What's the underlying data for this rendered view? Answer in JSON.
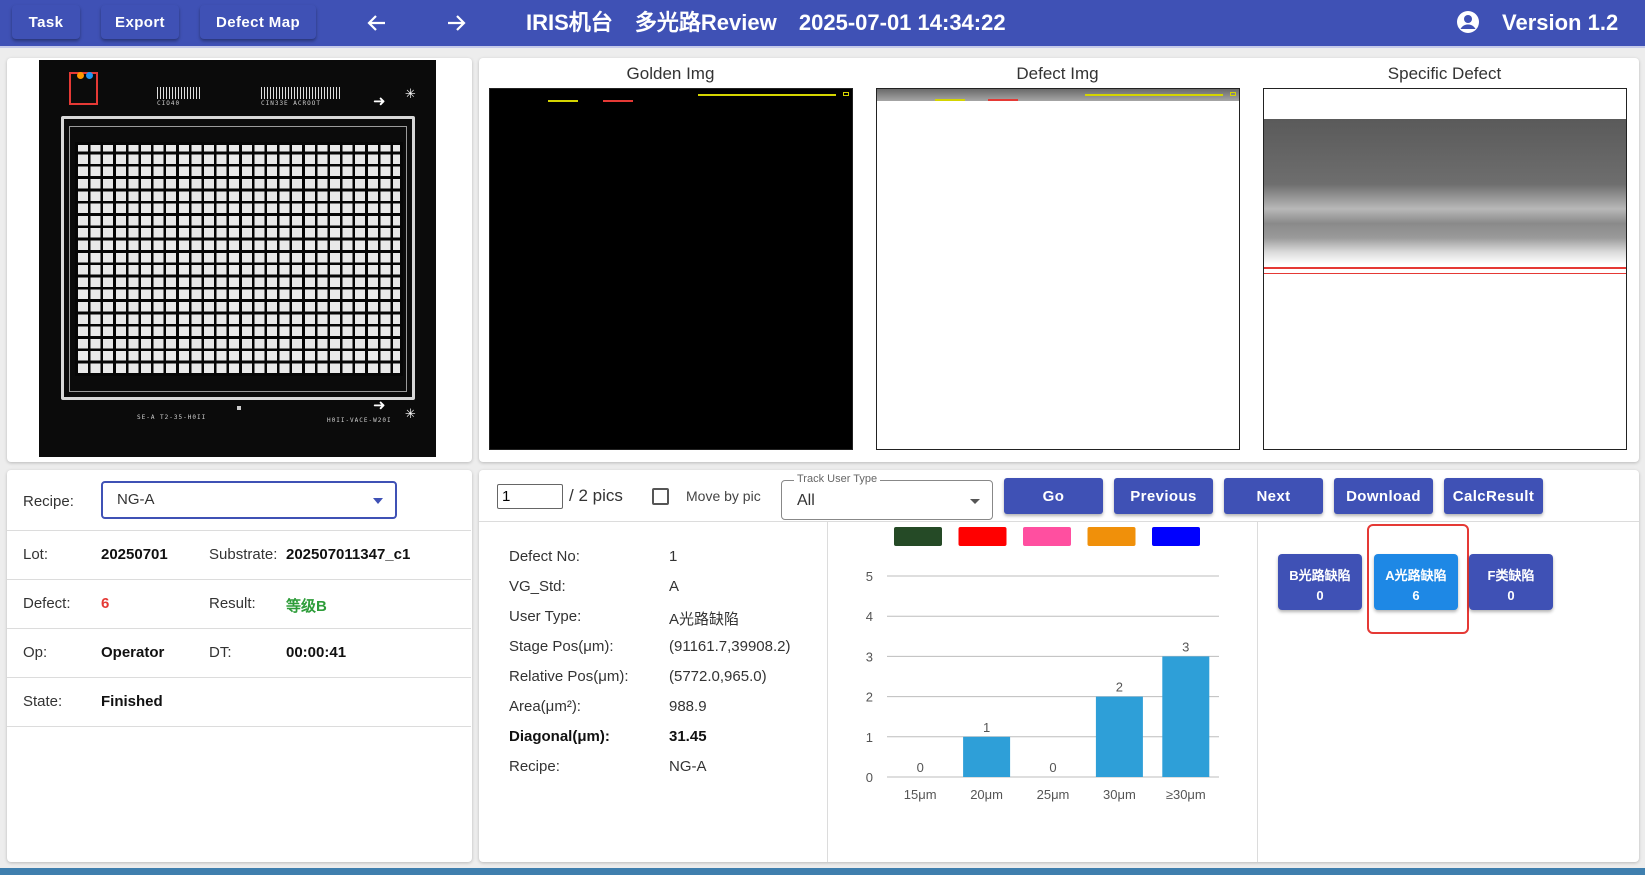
{
  "toolbar": {
    "task_label": "Task",
    "export_label": "Export",
    "defect_map_label": "Defect Map",
    "title_machine": "IRIS机台",
    "title_mode": "多光路Review",
    "title_datetime": "2025-07-01 14:34:22",
    "version": "Version 1.2",
    "icons": {
      "back": "arrow-left-icon",
      "forward": "arrow-right-icon",
      "user": "account-circle-icon"
    },
    "color": "#3f51b5"
  },
  "wafer": {
    "barcode_text_1": "CIO40",
    "barcode_text_2": "CIN33E ACROOT",
    "bottom_text_1": "SE-A T2-35-H0II",
    "bottom_text_2": "H0II-VACE-W20I"
  },
  "images": {
    "golden_title": "Golden Img",
    "defect_title": "Defect Img",
    "specific_title": "Specific Defect"
  },
  "info": {
    "recipe_label": "Recipe:",
    "recipe_value": "NG-A",
    "lot_label": "Lot:",
    "lot_value": "20250701",
    "substrate_label": "Substrate:",
    "substrate_value": "202507011347_c1",
    "defect_label": "Defect:",
    "defect_value": "6",
    "result_label": "Result:",
    "result_value": "等级B",
    "op_label": "Op:",
    "op_value": "Operator",
    "dt_label": "DT:",
    "dt_value": "00:00:41",
    "state_label": "State:",
    "state_value": "Finished",
    "colors": {
      "defect": "#e53935",
      "result": "#2e9d3a"
    }
  },
  "nav": {
    "page_value": "1",
    "total": "/ 2 pics",
    "move_by_pic_label": "Move by pic",
    "track_label": "Track User Type",
    "track_value": "All",
    "go_label": "Go",
    "previous_label": "Previous",
    "next_label": "Next",
    "download_label": "Download",
    "calc_label": "CalcResult"
  },
  "details": {
    "defect_no_label": "Defect No:",
    "defect_no_value": "1",
    "vg_std_label": "VG_Std:",
    "vg_std_value": "A",
    "user_type_label": "User Type:",
    "user_type_value": "A光路缺陷",
    "stage_pos_label": "Stage Pos(μm):",
    "stage_pos_value": "(91161.7,39908.2)",
    "relative_pos_label": "Relative Pos(μm):",
    "relative_pos_value": "(5772.0,965.0)",
    "area_label": "Area(μm²):",
    "area_value": "988.9",
    "diagonal_label": "Diagonal(μm):",
    "diagonal_value": "31.45",
    "recipe_label": "Recipe:",
    "recipe_value": "NG-A"
  },
  "chart_data": {
    "type": "bar",
    "categories": [
      "15μm",
      "20μm",
      "25μm",
      "30μm",
      "≥30μm"
    ],
    "values": [
      0,
      1,
      0,
      2,
      3
    ],
    "ylim": [
      0,
      5
    ],
    "yticks": [
      0,
      1,
      2,
      3,
      4,
      5
    ],
    "grid": true,
    "legend_colors": [
      "#254a26",
      "#ff0000",
      "#ff4fa0",
      "#f0900a",
      "#0000ff"
    ],
    "bar_color": "#2e9fd8"
  },
  "classes": [
    {
      "name": "B光路缺陷",
      "count": "0"
    },
    {
      "name": "A光路缺陷",
      "count": "6"
    },
    {
      "name": "F类缺陷",
      "count": "0"
    }
  ]
}
